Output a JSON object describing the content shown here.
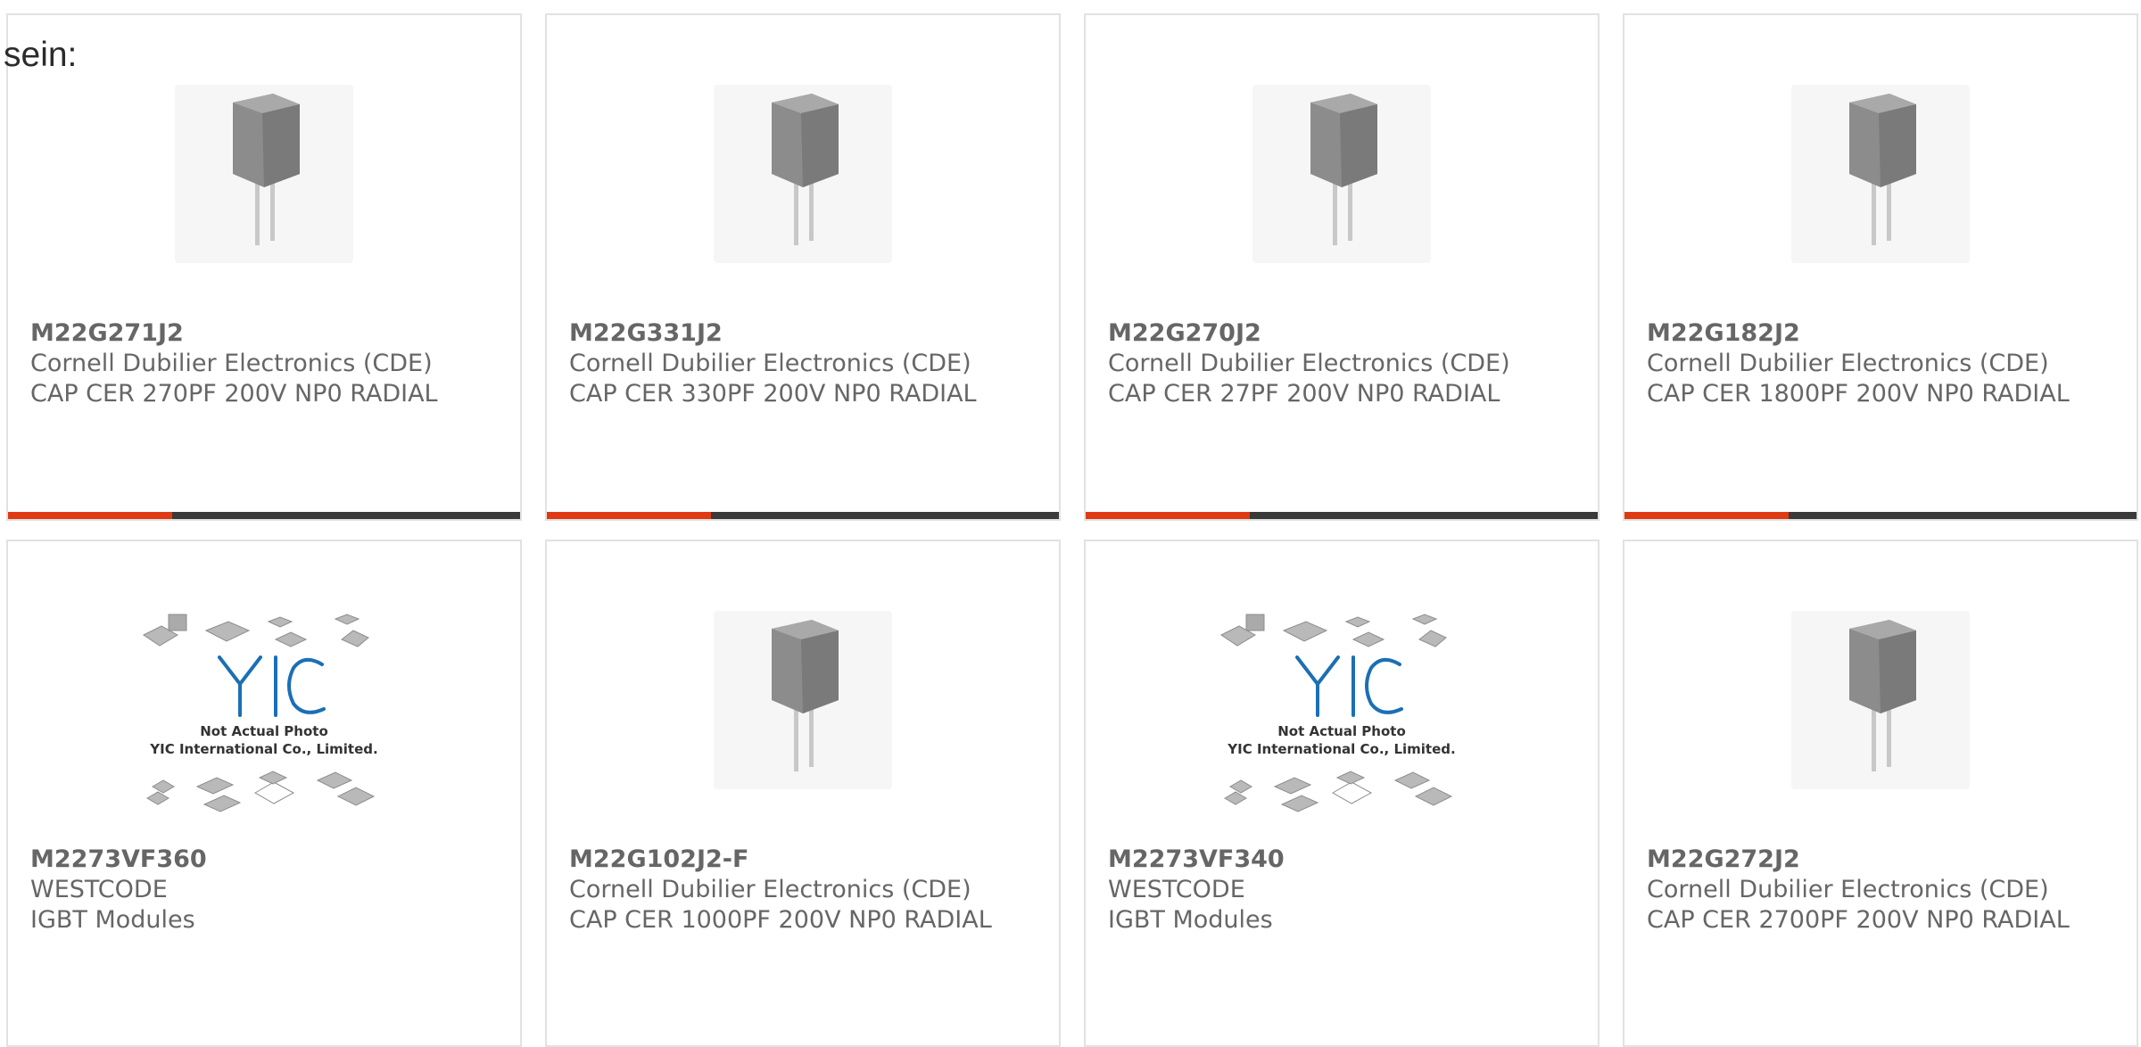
{
  "heading": "sein:",
  "colors": {
    "accent": "#e03a14",
    "bar": "#3a3a3a",
    "text": "#666666",
    "border": "#e2e2e2",
    "yic_blue": "#1b6fb5"
  },
  "products": [
    {
      "part": "M22G271J2",
      "maker": "Cornell Dubilier Electronics (CDE)",
      "desc": "CAP CER 270PF 200V NP0 RADIAL",
      "image": "radial-capacitor-photo"
    },
    {
      "part": "M22G331J2",
      "maker": "Cornell Dubilier Electronics (CDE)",
      "desc": "CAP CER 330PF 200V NP0 RADIAL",
      "image": "radial-capacitor-photo"
    },
    {
      "part": "M22G270J2",
      "maker": "Cornell Dubilier Electronics (CDE)",
      "desc": "CAP CER 27PF 200V NP0 RADIAL",
      "image": "radial-capacitor-photo"
    },
    {
      "part": "M22G182J2",
      "maker": "Cornell Dubilier Electronics (CDE)",
      "desc": "CAP CER 1800PF 200V NP0 RADIAL",
      "image": "radial-capacitor-photo"
    },
    {
      "part": "M2273VF360",
      "maker": "WESTCODE",
      "desc": "IGBT Modules",
      "image": "yic-placeholder-photo",
      "placeholder_line1": "Not Actual Photo",
      "placeholder_line2": "YIC International Co., Limited."
    },
    {
      "part": "M22G102J2-F",
      "maker": "Cornell Dubilier Electronics (CDE)",
      "desc": "CAP CER 1000PF 200V NP0 RADIAL",
      "image": "radial-capacitor-photo"
    },
    {
      "part": "M2273VF340",
      "maker": "WESTCODE",
      "desc": "IGBT Modules",
      "image": "yic-placeholder-photo",
      "placeholder_line1": "Not Actual Photo",
      "placeholder_line2": "YIC International Co., Limited."
    },
    {
      "part": "M22G272J2",
      "maker": "Cornell Dubilier Electronics (CDE)",
      "desc": "CAP CER 2700PF 200V NP0 RADIAL",
      "image": "radial-capacitor-photo"
    }
  ]
}
